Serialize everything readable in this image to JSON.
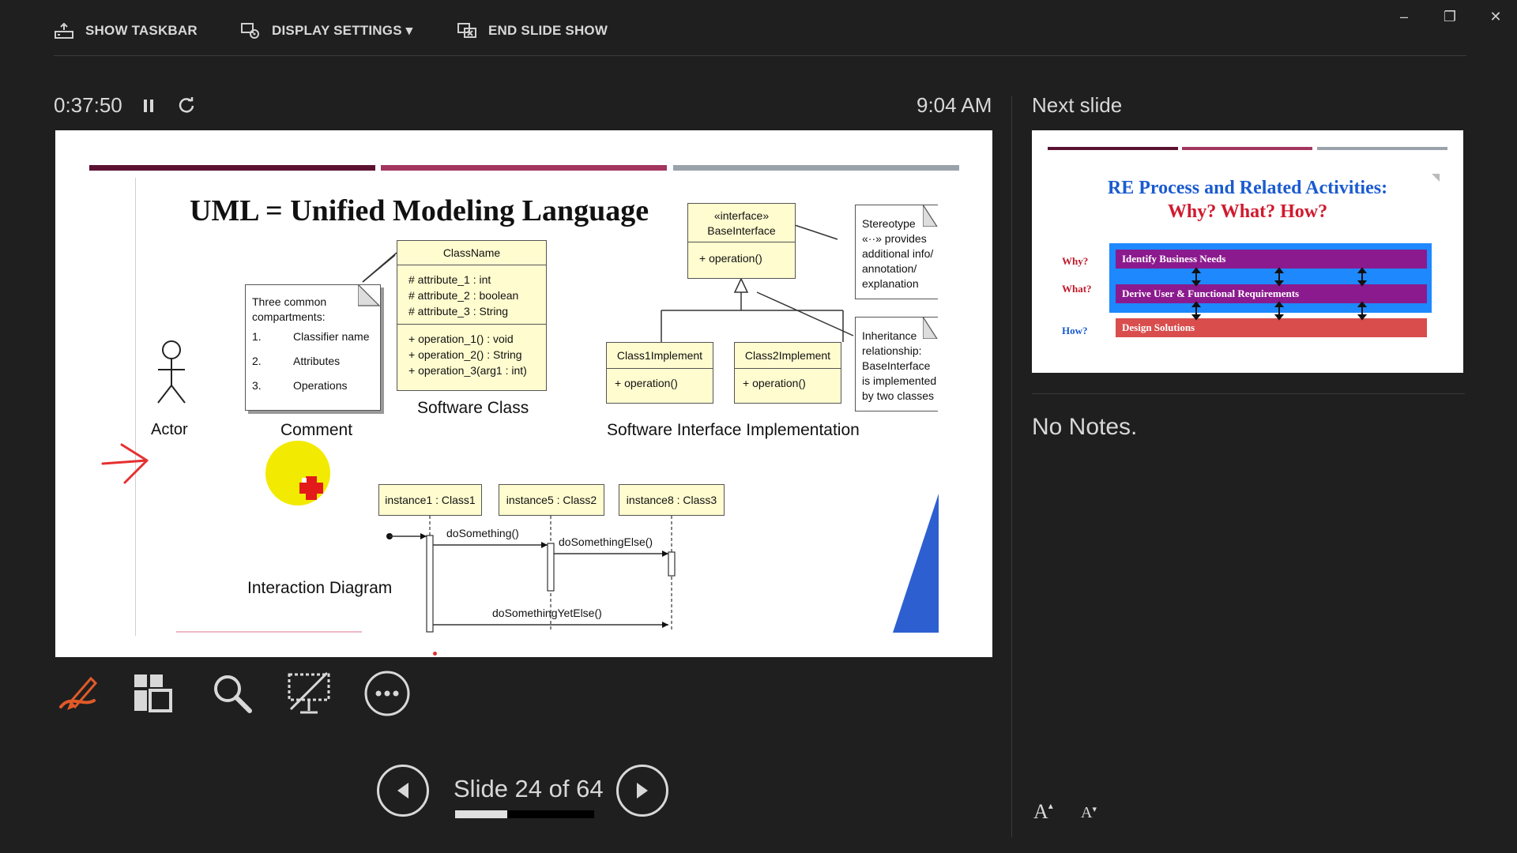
{
  "toolbar": {
    "show_taskbar": "SHOW TASKBAR",
    "display_settings": "DISPLAY SETTINGS ▾",
    "end_slide_show": "END SLIDE SHOW"
  },
  "window_controls": {
    "minimize": "–",
    "restore": "❐",
    "close": "✕"
  },
  "status": {
    "elapsed": "0:37:50",
    "clock": "9:04 AM"
  },
  "current_slide": {
    "title": "UML = Unified Modeling Language",
    "comment_note": {
      "header": "Three common compartments:",
      "items": [
        {
          "num": "1.",
          "text": "Classifier name"
        },
        {
          "num": "2.",
          "text": "Attributes"
        },
        {
          "num": "3.",
          "text": "Operations"
        }
      ]
    },
    "class_box": {
      "name": "ClassName",
      "attributes": [
        "#  attribute_1 : int",
        "#  attribute_2 : boolean",
        "#  attribute_3 : String"
      ],
      "operations": [
        "+  operation_1() : void",
        "+  operation_2() : String",
        "+  operation_3(arg1 : int)"
      ]
    },
    "interface_box": {
      "stereotype": "«interface»",
      "name": "BaseInterface",
      "op": "+  operation()"
    },
    "stereotype_note": [
      "Stereotype",
      "«··» provides",
      "additional info/",
      "annotation/",
      "explanation"
    ],
    "inheritance_note": [
      "Inheritance",
      "relationship:",
      "BaseInterface",
      "is implemented",
      "by two classes"
    ],
    "impl1": {
      "name": "Class1Implement",
      "op": "+  operation()"
    },
    "impl2": {
      "name": "Class2Implement",
      "op": "+  operation()"
    },
    "captions": {
      "actor": "Actor",
      "comment": "Comment",
      "software_class": "Software Class",
      "interface_impl": "Software Interface Implementation",
      "interaction": "Interaction Diagram"
    },
    "instances": [
      "instance1 : Class1",
      "instance5 : Class2",
      "instance8 : Class3"
    ],
    "messages": [
      "doSomething()",
      "doSomethingElse()",
      "doSomethingYetElse()"
    ]
  },
  "next_slide": {
    "label": "Next slide",
    "title_line1": "RE Process and Related Activities:",
    "title_line2": "Why? What? How?",
    "rows": [
      {
        "q": "Why?",
        "text": "Identify Business Needs"
      },
      {
        "q": "What?",
        "text": "Derive User & Functional Requirements"
      },
      {
        "q": "How?",
        "text": "Design Solutions"
      }
    ]
  },
  "notes": {
    "text": "No Notes."
  },
  "tools": [
    "pen-tool",
    "see-all-slides",
    "zoom",
    "black-screen",
    "more-options"
  ],
  "navigation": {
    "counter": "Slide 24 of 64",
    "progress": 0.375
  },
  "font_controls": {
    "increase": "A",
    "decrease": "A"
  },
  "colors": {
    "background": "#1f1f1f",
    "pen_accent": "#e05a28",
    "annotation_red": "#e53030",
    "laser_yellow": "#f2ea00"
  }
}
